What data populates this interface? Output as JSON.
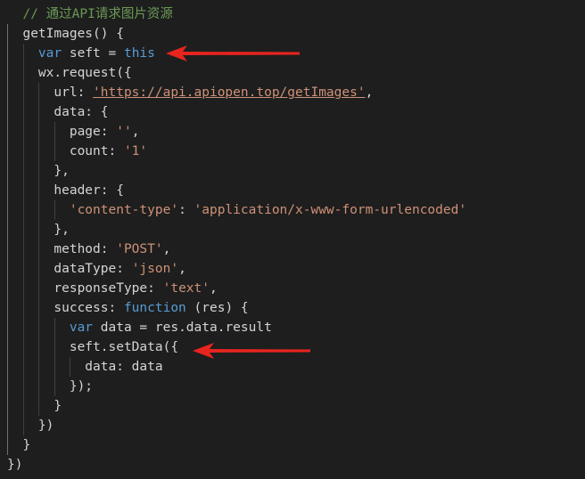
{
  "editor": {
    "background": "#1e1e1e",
    "colors": {
      "comment": "#6a9955",
      "keyword": "#569cd6",
      "string": "#ce9178",
      "default": "#d4d4d4",
      "arrow": "#e8241f"
    },
    "lines": [
      {
        "tokens": [
          {
            "t": "  // 通过API请求图片资源",
            "c": "comment"
          }
        ]
      },
      {
        "tokens": [
          {
            "t": "  getImages() {",
            "c": "default"
          }
        ]
      },
      {
        "tokens": [
          {
            "t": "    ",
            "c": "default"
          },
          {
            "t": "var",
            "c": "keyword"
          },
          {
            "t": " seft = ",
            "c": "default"
          },
          {
            "t": "this",
            "c": "keyword"
          }
        ]
      },
      {
        "tokens": [
          {
            "t": "    wx.request({",
            "c": "default"
          }
        ]
      },
      {
        "tokens": [
          {
            "t": "      url: ",
            "c": "default"
          },
          {
            "t": "'https://api.apiopen.top/getImages'",
            "c": "string",
            "u": true
          },
          {
            "t": ",",
            "c": "default"
          }
        ]
      },
      {
        "tokens": [
          {
            "t": "      data: {",
            "c": "default"
          }
        ]
      },
      {
        "tokens": [
          {
            "t": "        page: ",
            "c": "default"
          },
          {
            "t": "''",
            "c": "string"
          },
          {
            "t": ",",
            "c": "default"
          }
        ]
      },
      {
        "tokens": [
          {
            "t": "        count: ",
            "c": "default"
          },
          {
            "t": "'1'",
            "c": "string"
          }
        ]
      },
      {
        "tokens": [
          {
            "t": "      },",
            "c": "default"
          }
        ]
      },
      {
        "tokens": [
          {
            "t": "      header: {",
            "c": "default"
          }
        ]
      },
      {
        "tokens": [
          {
            "t": "        ",
            "c": "default"
          },
          {
            "t": "'content-type'",
            "c": "string"
          },
          {
            "t": ": ",
            "c": "default"
          },
          {
            "t": "'application/x-www-form-urlencoded'",
            "c": "string"
          }
        ]
      },
      {
        "tokens": [
          {
            "t": "      },",
            "c": "default"
          }
        ]
      },
      {
        "tokens": [
          {
            "t": "      method: ",
            "c": "default"
          },
          {
            "t": "'POST'",
            "c": "string"
          },
          {
            "t": ",",
            "c": "default"
          }
        ]
      },
      {
        "tokens": [
          {
            "t": "      dataType: ",
            "c": "default"
          },
          {
            "t": "'json'",
            "c": "string"
          },
          {
            "t": ",",
            "c": "default"
          }
        ]
      },
      {
        "tokens": [
          {
            "t": "      responseType: ",
            "c": "default"
          },
          {
            "t": "'text'",
            "c": "string"
          },
          {
            "t": ",",
            "c": "default"
          }
        ]
      },
      {
        "tokens": [
          {
            "t": "      success: ",
            "c": "default"
          },
          {
            "t": "function",
            "c": "keyword"
          },
          {
            "t": " (res) {",
            "c": "default"
          }
        ]
      },
      {
        "tokens": [
          {
            "t": "        ",
            "c": "default"
          },
          {
            "t": "var",
            "c": "keyword"
          },
          {
            "t": " data = res.data.result",
            "c": "default"
          }
        ]
      },
      {
        "tokens": [
          {
            "t": "        seft.setData({",
            "c": "default"
          }
        ]
      },
      {
        "tokens": [
          {
            "t": "          data: data",
            "c": "default"
          }
        ]
      },
      {
        "tokens": [
          {
            "t": "        });",
            "c": "default"
          }
        ]
      },
      {
        "tokens": [
          {
            "t": "      }",
            "c": "default"
          }
        ]
      },
      {
        "tokens": [
          {
            "t": "    })",
            "c": "default"
          }
        ]
      },
      {
        "tokens": [
          {
            "t": "  }",
            "c": "default"
          }
        ]
      },
      {
        "tokens": [
          {
            "t": "})",
            "c": "default"
          }
        ]
      }
    ]
  }
}
